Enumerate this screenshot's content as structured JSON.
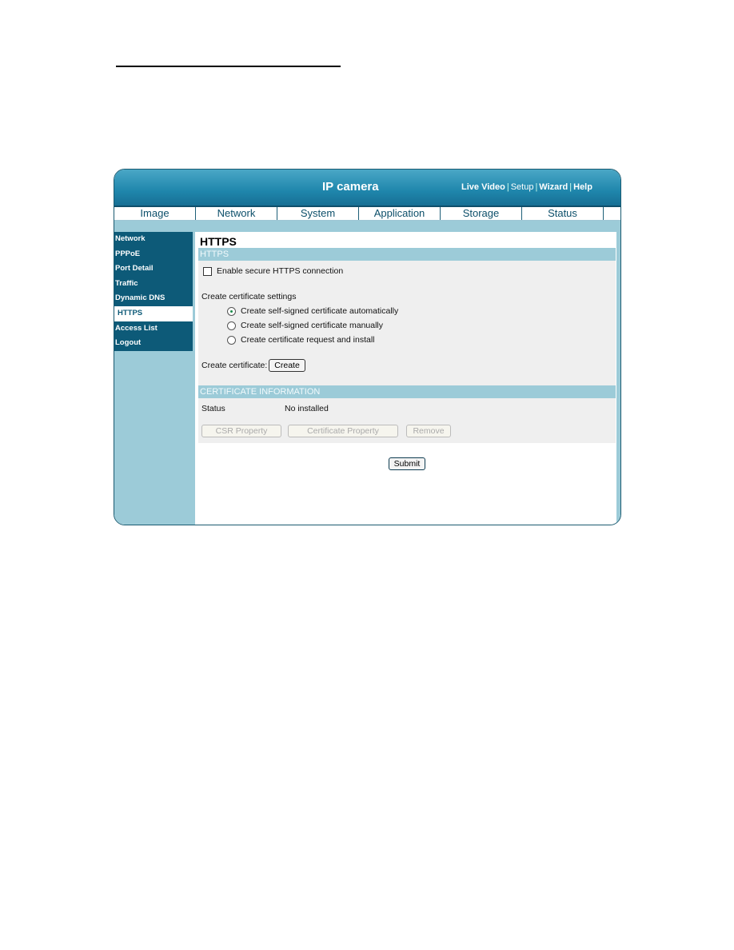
{
  "header": {
    "title": "IP camera",
    "links": [
      "Live Video",
      "Setup",
      "Wizard",
      "Help"
    ]
  },
  "tabs": [
    "Image",
    "Network",
    "System",
    "Application",
    "Storage",
    "Status"
  ],
  "sidebar": {
    "items": [
      "Network",
      "PPPoE",
      "Port Detail",
      "Traffic",
      "Dynamic DNS",
      "HTTPS",
      "Access List",
      "Logout"
    ],
    "active": "HTTPS"
  },
  "page": {
    "title": "HTTPS",
    "section1": "HTTPS",
    "enable_label": "Enable secure HTTPS connection",
    "enable_checked": false,
    "settings_label": "Create certificate settings",
    "options": [
      "Create self-signed certificate automatically",
      "Create self-signed certificate manually",
      "Create certificate request and install"
    ],
    "selected_option": 0,
    "create_label": "Create certificate:",
    "create_button": "Create",
    "section2": "CERTIFICATE INFORMATION",
    "status_label": "Status",
    "status_value": "No installed",
    "csr_button": "CSR Property",
    "cert_button": "Certificate Property",
    "remove_button": "Remove",
    "submit_button": "Submit"
  }
}
